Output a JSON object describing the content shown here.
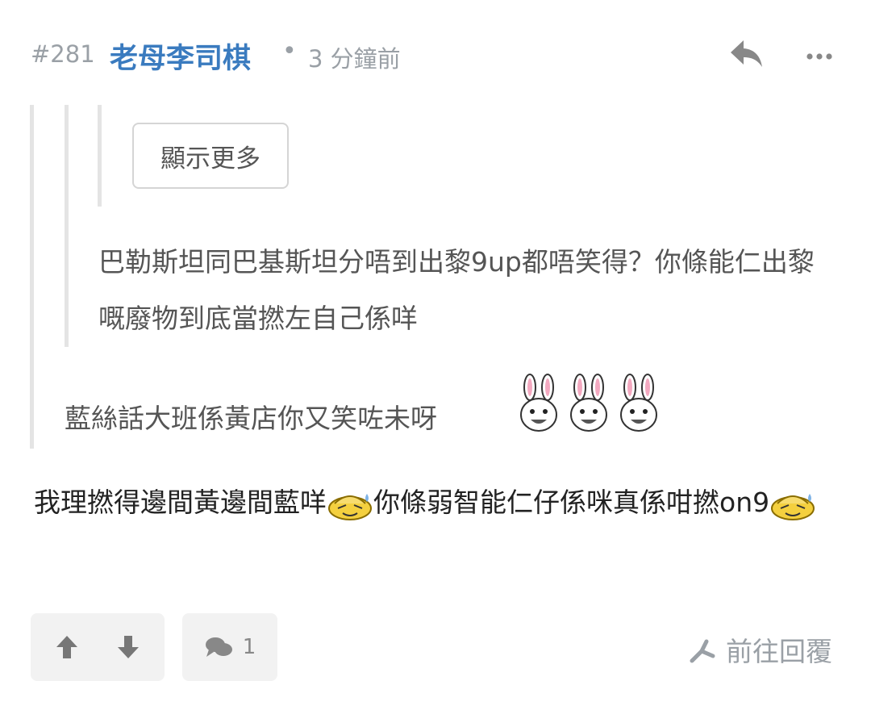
{
  "post": {
    "number": "#281",
    "username": "老母李司棋",
    "separator": "•",
    "time_ago": "3 分鐘前"
  },
  "quote": {
    "show_more_label": "顯示更多",
    "nested_text": "巴勒斯坦同巴基斯坦分唔到出黎9up都唔笑得？你條能仁出黎嘅廢物到底當撚左自己係咩",
    "outer_text": "藍絲話大班係黃店你又笑咗未呀"
  },
  "body": {
    "part1": "我理撚得邊間黃邊間藍咩",
    "part2": "你條弱智能仁仔係咪真係咁撚on9"
  },
  "footer": {
    "comment_count": "1",
    "goto_reply_label": "前往回覆"
  },
  "colors": {
    "username": "#3a7bbf",
    "meta": "#9aa0a6",
    "quote_bar": "#e4e4e4",
    "button_bg": "#f2f2f2"
  },
  "icons": [
    "reply-icon",
    "more-icon",
    "upvote-icon",
    "downvote-icon",
    "comment-icon",
    "goto-reply-icon",
    "bunny-emoji",
    "sweat-emoji"
  ]
}
